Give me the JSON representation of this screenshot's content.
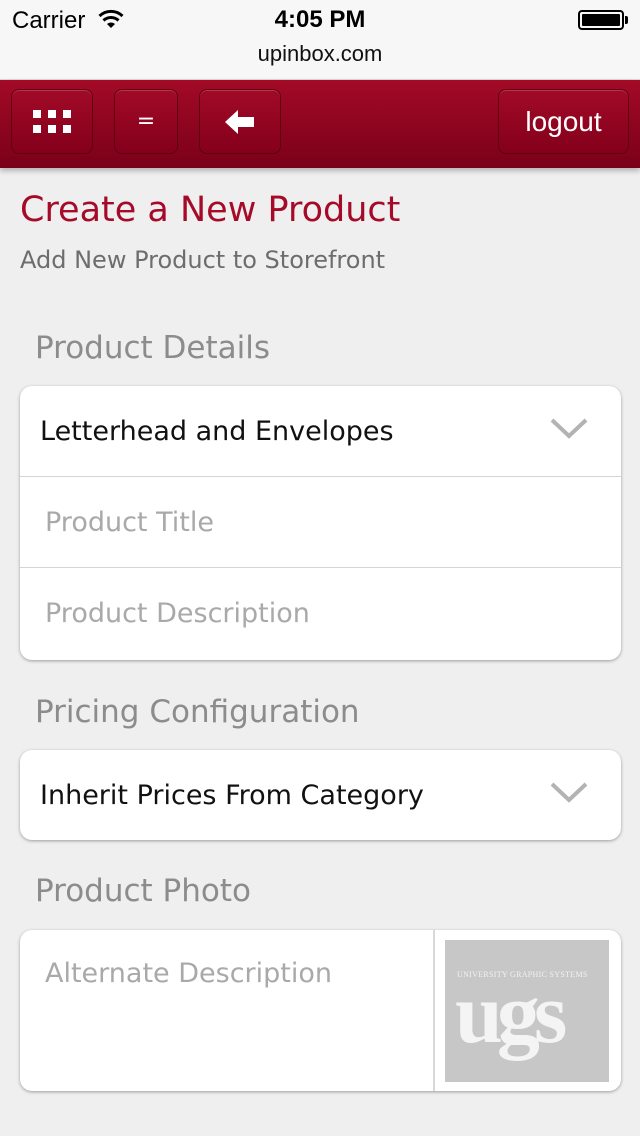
{
  "status_bar": {
    "carrier": "Carrier",
    "time": "4:05 PM",
    "url": "upinbox.com"
  },
  "nav": {
    "menu_icon": "grid-icon",
    "equals_label": "=",
    "back_icon": "arrow-left-icon",
    "logout_label": "logout",
    "accent_color": "#8e0421"
  },
  "header": {
    "title": "Create a New Product",
    "subtitle": "Add New Product to Storefront"
  },
  "product_details": {
    "section_label": "Product Details",
    "category_value": "Letterhead and Envelopes",
    "title_placeholder": "Product Title",
    "description_placeholder": "Product Description"
  },
  "pricing": {
    "section_label": "Pricing Configuration",
    "selected_value": "Inherit Prices From Category"
  },
  "photo": {
    "section_label": "Product Photo",
    "alt_placeholder": "Alternate Description",
    "logo_tagline": "UNIVERSITY GRAPHIC SYSTEMS",
    "logo_text": "ugs"
  }
}
